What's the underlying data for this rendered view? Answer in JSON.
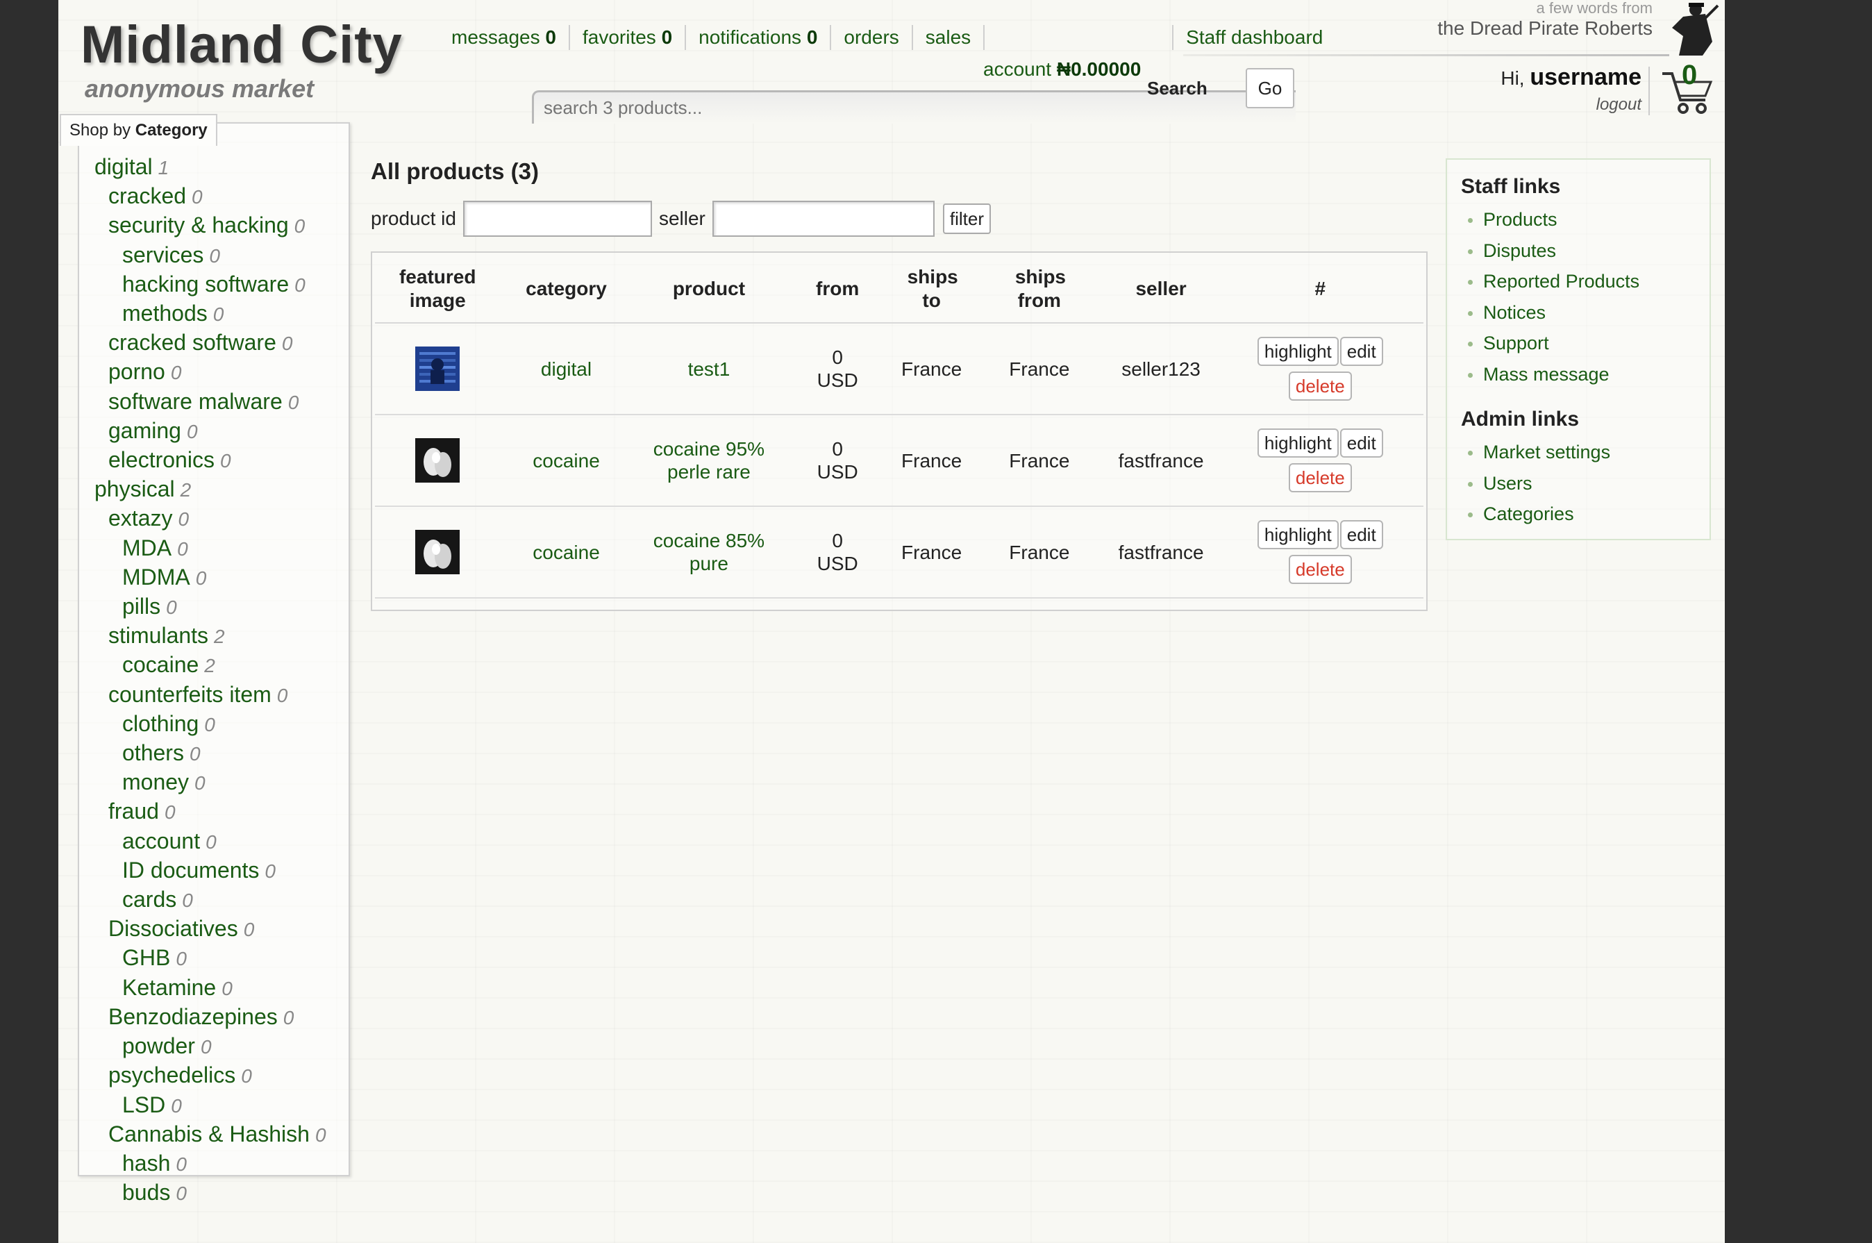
{
  "brand": {
    "title": "Midland City",
    "subtitle": "anonymous market"
  },
  "nav": [
    {
      "label": "messages",
      "count": "0"
    },
    {
      "label": "favorites",
      "count": "0"
    },
    {
      "label": "notifications",
      "count": "0"
    },
    {
      "label": "orders"
    },
    {
      "label": "sales"
    }
  ],
  "staff_dashboard": "Staff dashboard",
  "account": {
    "label": "account",
    "value": "₦0.00000"
  },
  "search": {
    "placeholder": "search 3 products...",
    "label": "Search",
    "go": "Go"
  },
  "dpr": {
    "small": "a few words from",
    "big": "the Dread Pirate Roberts"
  },
  "user": {
    "hi": "Hi,",
    "name": "username",
    "logout": "logout"
  },
  "cart": {
    "count": "0"
  },
  "sidebar": {
    "tab_prefix": "Shop by ",
    "tab_bold": "Category",
    "categories": [
      {
        "label": "digital",
        "count": "1"
      },
      {
        "label": "cracked",
        "count": "0"
      },
      {
        "label": "security & hacking",
        "count": "0"
      },
      {
        "label": "services",
        "count": "0"
      },
      {
        "label": "hacking software",
        "count": "0"
      },
      {
        "label": "methods",
        "count": "0"
      },
      {
        "label": "cracked software",
        "count": "0"
      },
      {
        "label": "porno",
        "count": "0"
      },
      {
        "label": "software malware",
        "count": "0"
      },
      {
        "label": "gaming",
        "count": "0"
      },
      {
        "label": "electronics",
        "count": "0"
      },
      {
        "label": "physical",
        "count": "2"
      },
      {
        "label": "extazy",
        "count": "0"
      },
      {
        "label": "MDA",
        "count": "0"
      },
      {
        "label": "MDMA",
        "count": "0"
      },
      {
        "label": "pills",
        "count": "0"
      },
      {
        "label": "stimulants",
        "count": "2"
      },
      {
        "label": "cocaine",
        "count": "2"
      },
      {
        "label": "counterfeits item",
        "count": "0"
      },
      {
        "label": "clothing",
        "count": "0"
      },
      {
        "label": "others",
        "count": "0"
      },
      {
        "label": "money",
        "count": "0"
      },
      {
        "label": "fraud",
        "count": "0"
      },
      {
        "label": "account",
        "count": "0"
      },
      {
        "label": "ID documents",
        "count": "0"
      },
      {
        "label": "cards",
        "count": "0"
      },
      {
        "label": "Dissociatives",
        "count": "0"
      },
      {
        "label": "GHB",
        "count": "0"
      },
      {
        "label": "Ketamine",
        "count": "0"
      },
      {
        "label": "Benzodiazepines",
        "count": "0"
      },
      {
        "label": "powder",
        "count": "0"
      },
      {
        "label": "psychedelics",
        "count": "0"
      },
      {
        "label": "LSD",
        "count": "0"
      },
      {
        "label": "Cannabis & Hashish",
        "count": "0"
      },
      {
        "label": "hash",
        "count": "0"
      },
      {
        "label": "buds",
        "count": "0"
      }
    ]
  },
  "main": {
    "title": "All products (3)",
    "filter": {
      "product_id_label": "product id",
      "seller_label": "seller",
      "button": "filter"
    },
    "columns": [
      "featured image",
      "category",
      "product",
      "from",
      "ships to",
      "ships from",
      "seller",
      "#"
    ],
    "rows": [
      {
        "image": "blue-digital-thumbnail",
        "category": "digital",
        "product": "test1",
        "from": "0 USD",
        "ships_to": "France",
        "ships_from": "France",
        "seller": "seller123"
      },
      {
        "image": "white-powder-thumbnail",
        "category": "cocaine",
        "product": "cocaine 95% perle rare",
        "from": "0 USD",
        "ships_to": "France",
        "ships_from": "France",
        "seller": "fastfrance"
      },
      {
        "image": "white-powder-thumbnail",
        "category": "cocaine",
        "product": "cocaine 85% pure",
        "from": "0 USD",
        "ships_to": "France",
        "ships_from": "France",
        "seller": "fastfrance"
      }
    ],
    "actions": {
      "highlight": "highlight",
      "edit": "edit",
      "delete": "delete"
    }
  },
  "staff_panel": {
    "title": "Staff links",
    "links": [
      "Products",
      "Disputes",
      "Reported Products",
      "Notices",
      "Support",
      "Mass message"
    ],
    "admin_title": "Admin links",
    "admin_links": [
      "Market settings",
      "Users",
      "Categories"
    ]
  },
  "colors": {
    "link": "#1a5b14",
    "delete": "#d63a2a",
    "background": "#f8f8f3",
    "frame": "#2e2e2e"
  }
}
